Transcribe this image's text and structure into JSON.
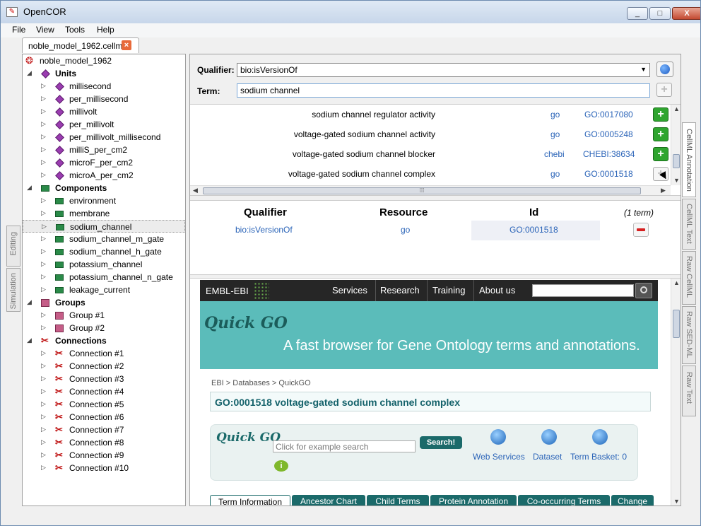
{
  "window": {
    "title": "OpenCOR",
    "minimize": "_",
    "maximize": "□",
    "close": "X"
  },
  "menu": [
    "File",
    "View",
    "Tools",
    "Help"
  ],
  "doc_tab": {
    "label": "noble_model_1962.cellml*",
    "close": "×"
  },
  "left_tabs": [
    "Editing",
    "Simulation"
  ],
  "right_tabs": [
    "CellML Annotation",
    "CellML Text",
    "Raw CellML",
    "Raw SED-ML",
    "Raw Text"
  ],
  "tree": {
    "root": "noble_model_1962",
    "units_header": "Units",
    "units": [
      "millisecond",
      "per_millisecond",
      "millivolt",
      "per_millivolt",
      "per_millivolt_millisecond",
      "milliS_per_cm2",
      "microF_per_cm2",
      "microA_per_cm2"
    ],
    "components_header": "Components",
    "components": [
      "environment",
      "membrane",
      "sodium_channel",
      "sodium_channel_m_gate",
      "sodium_channel_h_gate",
      "potassium_channel",
      "potassium_channel_n_gate",
      "leakage_current"
    ],
    "groups_header": "Groups",
    "groups": [
      "Group #1",
      "Group #2"
    ],
    "connections_header": "Connections",
    "connections": [
      "Connection #1",
      "Connection #2",
      "Connection #3",
      "Connection #4",
      "Connection #5",
      "Connection #6",
      "Connection #7",
      "Connection #8",
      "Connection #9",
      "Connection #10"
    ]
  },
  "qualifier": {
    "label": "Qualifier:",
    "value": "bio:isVersionOf"
  },
  "term": {
    "label": "Term:",
    "value": "sodium channel"
  },
  "results": [
    {
      "name": "sodium channel regulator activity",
      "resource": "go",
      "id": "GO:0017080"
    },
    {
      "name": "voltage-gated sodium channel activity",
      "resource": "go",
      "id": "GO:0005248"
    },
    {
      "name": "voltage-gated sodium channel blocker",
      "resource": "chebi",
      "id": "CHEBI:38634"
    },
    {
      "name": "voltage-gated sodium channel complex",
      "resource": "go",
      "id": "GO:0001518"
    }
  ],
  "annotations": {
    "headers": {
      "qualifier": "Qualifier",
      "resource": "Resource",
      "id": "Id"
    },
    "count": "(1 term)",
    "row": {
      "qualifier": "bio:isVersionOf",
      "resource": "go",
      "id": "GO:0001518"
    }
  },
  "web": {
    "ebi_logo": "EMBL-EBI",
    "nav": [
      "Services",
      "Research",
      "Training",
      "About us"
    ],
    "quickgo_logo": "Quick GO",
    "tagline": "A fast browser for Gene Ontology terms and annotations.",
    "breadcrumb": "EBI > Databases > QuickGO",
    "term_title": "GO:0001518 voltage-gated sodium channel complex",
    "search_placeholder": "Click for example search",
    "search_button": "Search!",
    "services": [
      "Web Services",
      "Dataset",
      "Term Basket: 0"
    ],
    "tabs": [
      "Term Information",
      "Ancestor Chart",
      "Child Terms",
      "Protein Annotation",
      "Co-occurring Terms",
      "Change"
    ]
  }
}
